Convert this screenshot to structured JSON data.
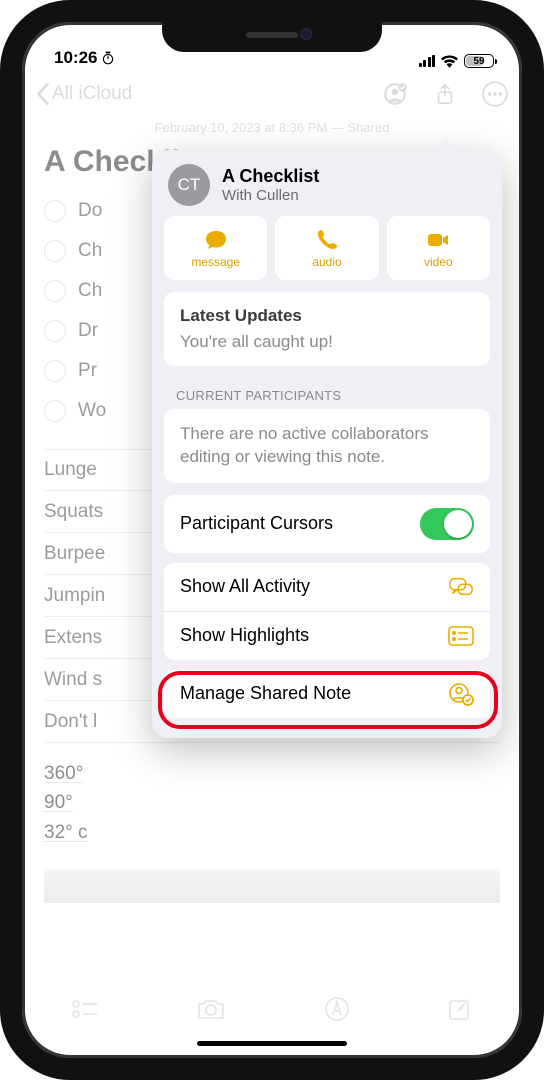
{
  "status": {
    "time": "10:26",
    "battery": "59"
  },
  "nav": {
    "back_label": "All iCloud"
  },
  "meta": {
    "line": "February 10, 2023 at 8:36 PM — Shared"
  },
  "note": {
    "title": "A Checklist",
    "items": [
      "Do",
      "Ch",
      "Ch",
      "Dr",
      "Pr",
      "Wo"
    ],
    "table_rows": [
      "Lunge",
      "Squats",
      "Burpee",
      "Jumpin",
      "Extens",
      "Wind s",
      "Don't l"
    ],
    "numbers": [
      "360°",
      "90°",
      "32° c"
    ]
  },
  "popover": {
    "avatar_initials": "CT",
    "title": "A Checklist",
    "subtitle": "With Cullen",
    "comm": {
      "message": "message",
      "audio": "audio",
      "video": "video"
    },
    "updates": {
      "header": "Latest Updates",
      "body": "You're all caught up!"
    },
    "participants_label": "CURRENT PARTICIPANTS",
    "participants_body": "There are no active collaborators editing or viewing this note.",
    "rows": {
      "cursors": "Participant Cursors",
      "activity": "Show All Activity",
      "highlights": "Show Highlights",
      "manage": "Manage Shared Note"
    }
  }
}
